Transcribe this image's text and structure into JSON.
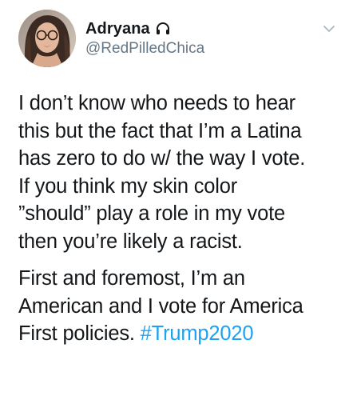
{
  "user": {
    "display_name": "Adryana",
    "handle": "@RedPilledChica",
    "badge_icon": "headphones-icon",
    "avatar_icon": "avatar-photo"
  },
  "menu_icon": "chevron-down-icon",
  "tweet": {
    "paragraph_1": [
      "I don’t know who needs to hear",
      "this but the fact that I’m a Latina",
      "has zero to do w/ the way I vote.",
      "If you think my skin color",
      "”should” play a role in my vote",
      "then you’re likely a racist."
    ],
    "paragraph_2": [
      "First and foremost, I’m an",
      "American and I vote for America"
    ],
    "paragraph_2_last_line_text": "First policies. ",
    "hashtag": "#Trump2020"
  },
  "colors": {
    "text": "#14171a",
    "secondary": "#657786",
    "link": "#1da1f2"
  }
}
